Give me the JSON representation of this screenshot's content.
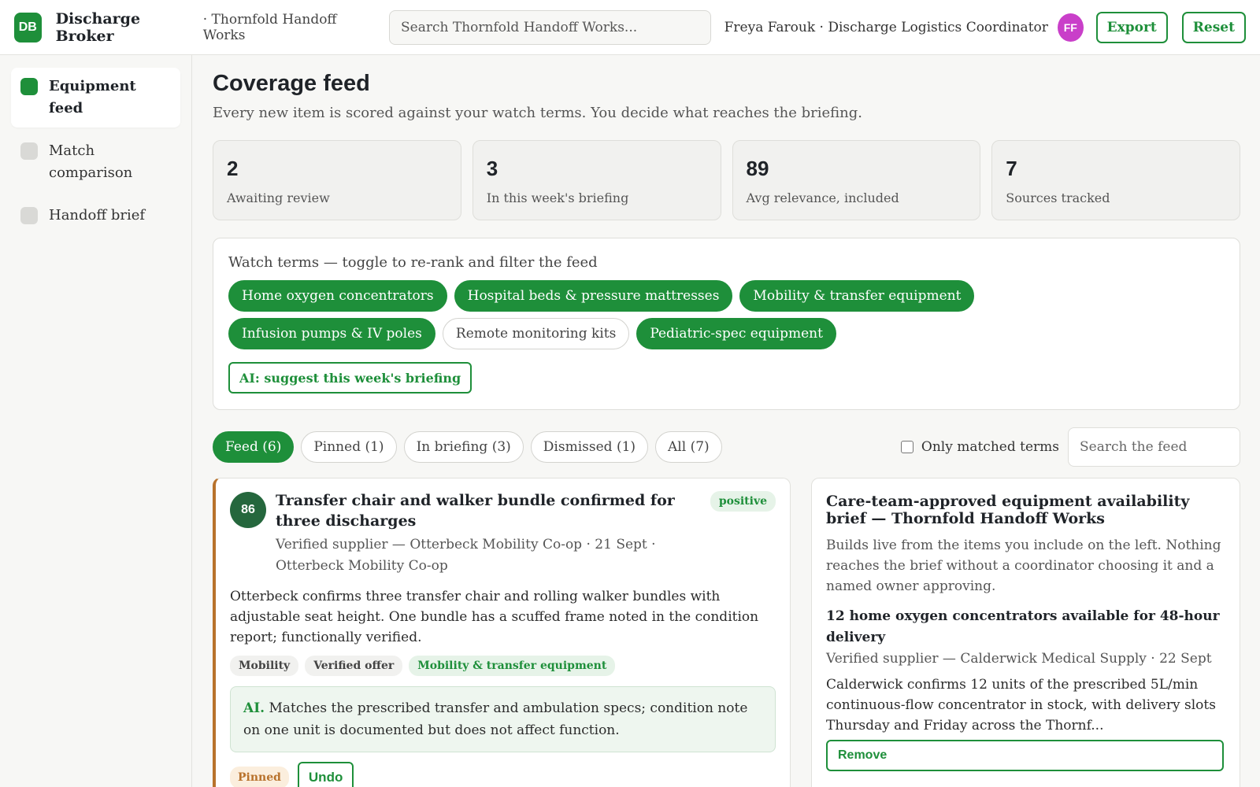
{
  "app": {
    "logo": "DB",
    "title": "Discharge Broker",
    "workspace": "· Thornfold Handoff Works",
    "search_placeholder": "Search Thornfold Handoff Works...",
    "user": "Freya Farouk · Discharge Logistics Coordinator",
    "avatar": "FF",
    "export_label": "Export",
    "reset_label": "Reset"
  },
  "sidebar": {
    "items": [
      {
        "label": "Equipment feed",
        "active": true
      },
      {
        "label": "Match comparison",
        "active": false
      },
      {
        "label": "Handoff brief",
        "active": false
      }
    ]
  },
  "page": {
    "title": "Coverage feed",
    "subtitle": "Every new item is scored against your watch terms. You decide what reaches the briefing."
  },
  "stats": [
    {
      "value": "2",
      "label": "Awaiting review"
    },
    {
      "value": "3",
      "label": "In this week's briefing"
    },
    {
      "value": "89",
      "label": "Avg relevance, included"
    },
    {
      "value": "7",
      "label": "Sources tracked"
    }
  ],
  "watch": {
    "title": "Watch terms — toggle to re-rank and filter the feed",
    "terms": [
      {
        "label": "Home oxygen concentrators",
        "on": true
      },
      {
        "label": "Hospital beds & pressure mattresses",
        "on": true
      },
      {
        "label": "Mobility & transfer equipment",
        "on": true
      },
      {
        "label": "Infusion pumps & IV poles",
        "on": true
      },
      {
        "label": "Remote monitoring kits",
        "on": false
      },
      {
        "label": "Pediatric-spec equipment",
        "on": true
      }
    ],
    "ai_suggest_label": "AI: suggest this week's briefing"
  },
  "filters": {
    "tabs": [
      {
        "label": "Feed (6)",
        "on": true
      },
      {
        "label": "Pinned (1)",
        "on": false
      },
      {
        "label": "In briefing (3)",
        "on": false
      },
      {
        "label": "Dismissed (1)",
        "on": false
      },
      {
        "label": "All (7)",
        "on": false
      }
    ],
    "only_matched_label": "Only matched terms",
    "search_placeholder": "Search the feed"
  },
  "feed_item": {
    "score": "86",
    "title": "Transfer chair and walker bundle confirmed for three discharges",
    "sentiment": "positive",
    "source": "Verified supplier — Otterbeck Mobility Co-op · 21 Sept · Otterbeck Mobility Co-op",
    "body": "Otterbeck confirms three transfer chair and rolling walker bundles with adjustable seat height. One bundle has a scuffed frame noted in the condition report; functionally verified.",
    "tags": [
      "Mobility",
      "Verified offer"
    ],
    "matched_tag": "Mobility & transfer equipment",
    "ai_prefix": "AI.",
    "ai_text": "Matches the prescribed transfer and ambulation specs; condition note on one unit is documented but does not affect function.",
    "pinned_label": "Pinned",
    "undo_label": "Undo"
  },
  "brief": {
    "title": "Care-team-approved equipment availability brief — Thornfold Handoff Works",
    "subtitle": "Builds live from the items you include on the left. Nothing reaches the brief without a coordinator choosing it and a named owner approving.",
    "item_title": "12 home oxygen concentrators available for 48-hour delivery",
    "item_source": "Verified supplier — Calderwick Medical Supply · 22 Sept",
    "item_body": "Calderwick confirms 12 units of the prescribed 5L/min continuous-flow concentrator in stock, with delivery slots Thursday and Friday across the Thornf...",
    "remove_label": "Remove"
  },
  "colors": {
    "accent": "#1e8f3a",
    "avatar": "#c93fc9",
    "score": "#25673d",
    "card_border": "#b8722c"
  }
}
